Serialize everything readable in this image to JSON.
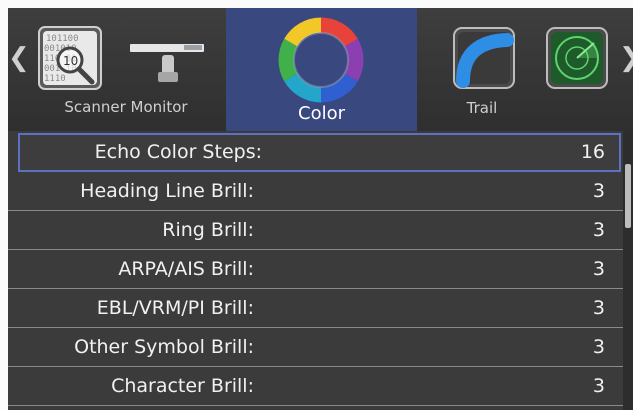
{
  "carousel": {
    "prev_arrow": "❮",
    "next_arrow": "❯",
    "tabs": [
      {
        "label": "Scanner Monitor",
        "icon": "binary-magnifier-icon"
      },
      {
        "label": "Color",
        "icon": "color-wheel-icon",
        "selected": true
      },
      {
        "label": "Trail",
        "icon": "trail-arc-icon"
      },
      {
        "label": "",
        "icon": "radar-scope-icon"
      }
    ],
    "accent": "#39487e"
  },
  "settings": {
    "rows": [
      {
        "name": "Echo Color Steps:",
        "value": "16",
        "selected": true
      },
      {
        "name": "Heading Line Brill:",
        "value": "3"
      },
      {
        "name": "Ring Brill:",
        "value": "3"
      },
      {
        "name": "ARPA/AIS Brill:",
        "value": "3"
      },
      {
        "name": "EBL/VRM/PI Brill:",
        "value": "3"
      },
      {
        "name": "Other Symbol Brill:",
        "value": "3"
      },
      {
        "name": "Character Brill:",
        "value": "3"
      }
    ],
    "selection_border": "#5d71c2"
  }
}
